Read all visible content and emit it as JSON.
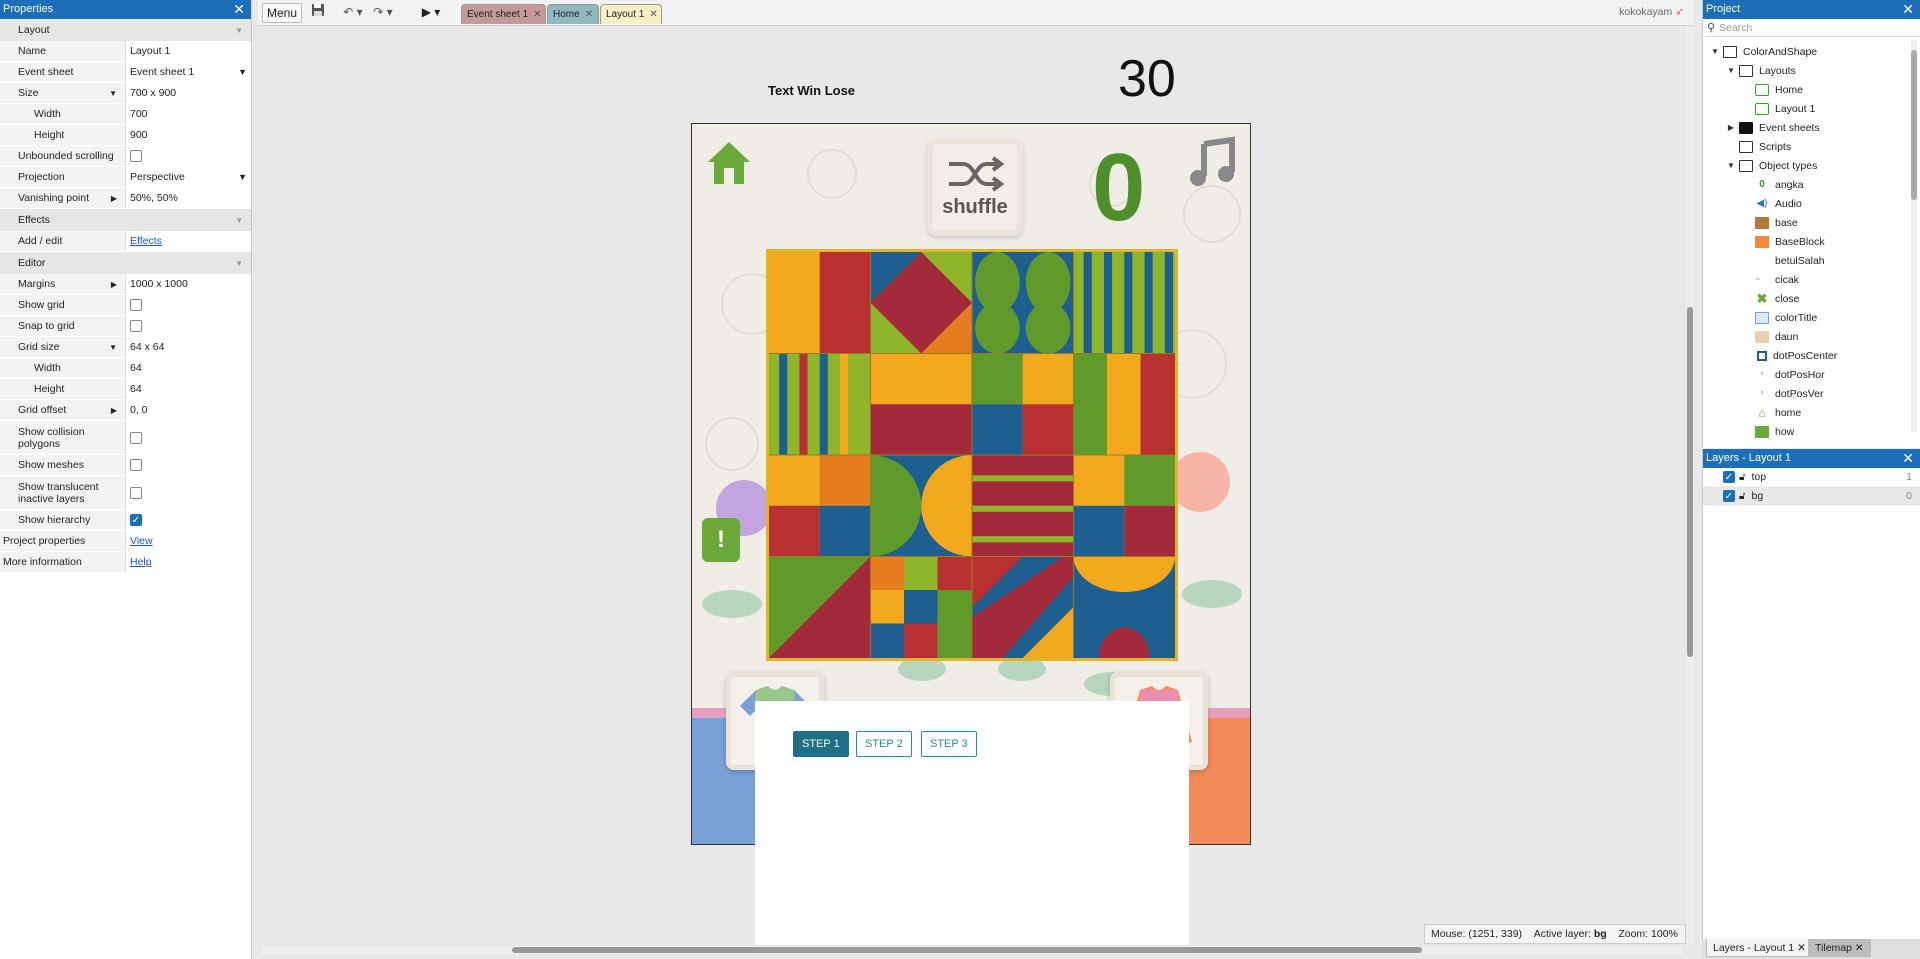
{
  "properties": {
    "title": "Properties",
    "sections": {
      "layout": "Layout",
      "effects": "Effects",
      "editor": "Editor"
    },
    "name_label": "Name",
    "name_value": "Layout 1",
    "event_sheet_label": "Event sheet",
    "event_sheet_value": "Event sheet 1",
    "size_label": "Size",
    "size_value": "700 x 900",
    "width_label": "Width",
    "width_value": "700",
    "height_label": "Height",
    "height_value": "900",
    "unbounded_label": "Unbounded scrolling",
    "projection_label": "Projection",
    "projection_value": "Perspective",
    "vanishing_label": "Vanishing point",
    "vanishing_value": "50%, 50%",
    "add_edit_label": "Add / edit",
    "add_edit_link": "Effects",
    "margins_label": "Margins",
    "margins_value": "1000 x 1000",
    "show_grid_label": "Show grid",
    "snap_grid_label": "Snap to grid",
    "grid_size_label": "Grid size",
    "grid_size_value": "64 x 64",
    "grid_width_label": "Width",
    "grid_width_value": "64",
    "grid_height_label": "Height",
    "grid_height_value": "64",
    "grid_offset_label": "Grid offset",
    "grid_offset_value": "0, 0",
    "show_collision_label": "Show collision polygons",
    "show_meshes_label": "Show meshes",
    "show_translucent_label": "Show translucent inactive layers",
    "show_hierarchy_label": "Show hierarchy",
    "project_props_label": "Project properties",
    "project_props_link": "View",
    "more_info_label": "More information",
    "more_info_link": "Help"
  },
  "toolbar": {
    "menu_label": "Menu",
    "tabs": [
      "Event sheet 1",
      "Home",
      "Layout 1"
    ],
    "user": "kokokayam"
  },
  "canvas": {
    "text_win_lose": "Text Win Lose",
    "timer": "30",
    "score": "0",
    "shuffle_label": "shuffle",
    "steps": [
      "STEP 1",
      "STEP 2",
      "STEP 3"
    ]
  },
  "status": {
    "mouse": "Mouse: (1251, 339)",
    "active_layer_label": "Active layer:",
    "active_layer_value": "bg",
    "zoom": "Zoom: 100%"
  },
  "project": {
    "title": "Project",
    "search_placeholder": "Search",
    "root": "ColorAndShape",
    "layouts_folder": "Layouts",
    "layouts": [
      "Home",
      "Layout 1"
    ],
    "event_sheets_folder": "Event sheets",
    "scripts_folder": "Scripts",
    "object_types_folder": "Object types",
    "objects": [
      "angka",
      "Audio",
      "base",
      "BaseBlock",
      "betulSalah",
      "cicak",
      "close",
      "colorTitle",
      "daun",
      "dotPosCenter",
      "dotPosHor",
      "dotPosVer",
      "home",
      "how"
    ]
  },
  "layers": {
    "title": "Layers - Layout 1",
    "items": [
      {
        "name": "top",
        "index": "1"
      },
      {
        "name": "bg",
        "index": "0"
      }
    ]
  },
  "bottom_tabs": [
    "Layers - Layout 1",
    "Tilemap"
  ]
}
